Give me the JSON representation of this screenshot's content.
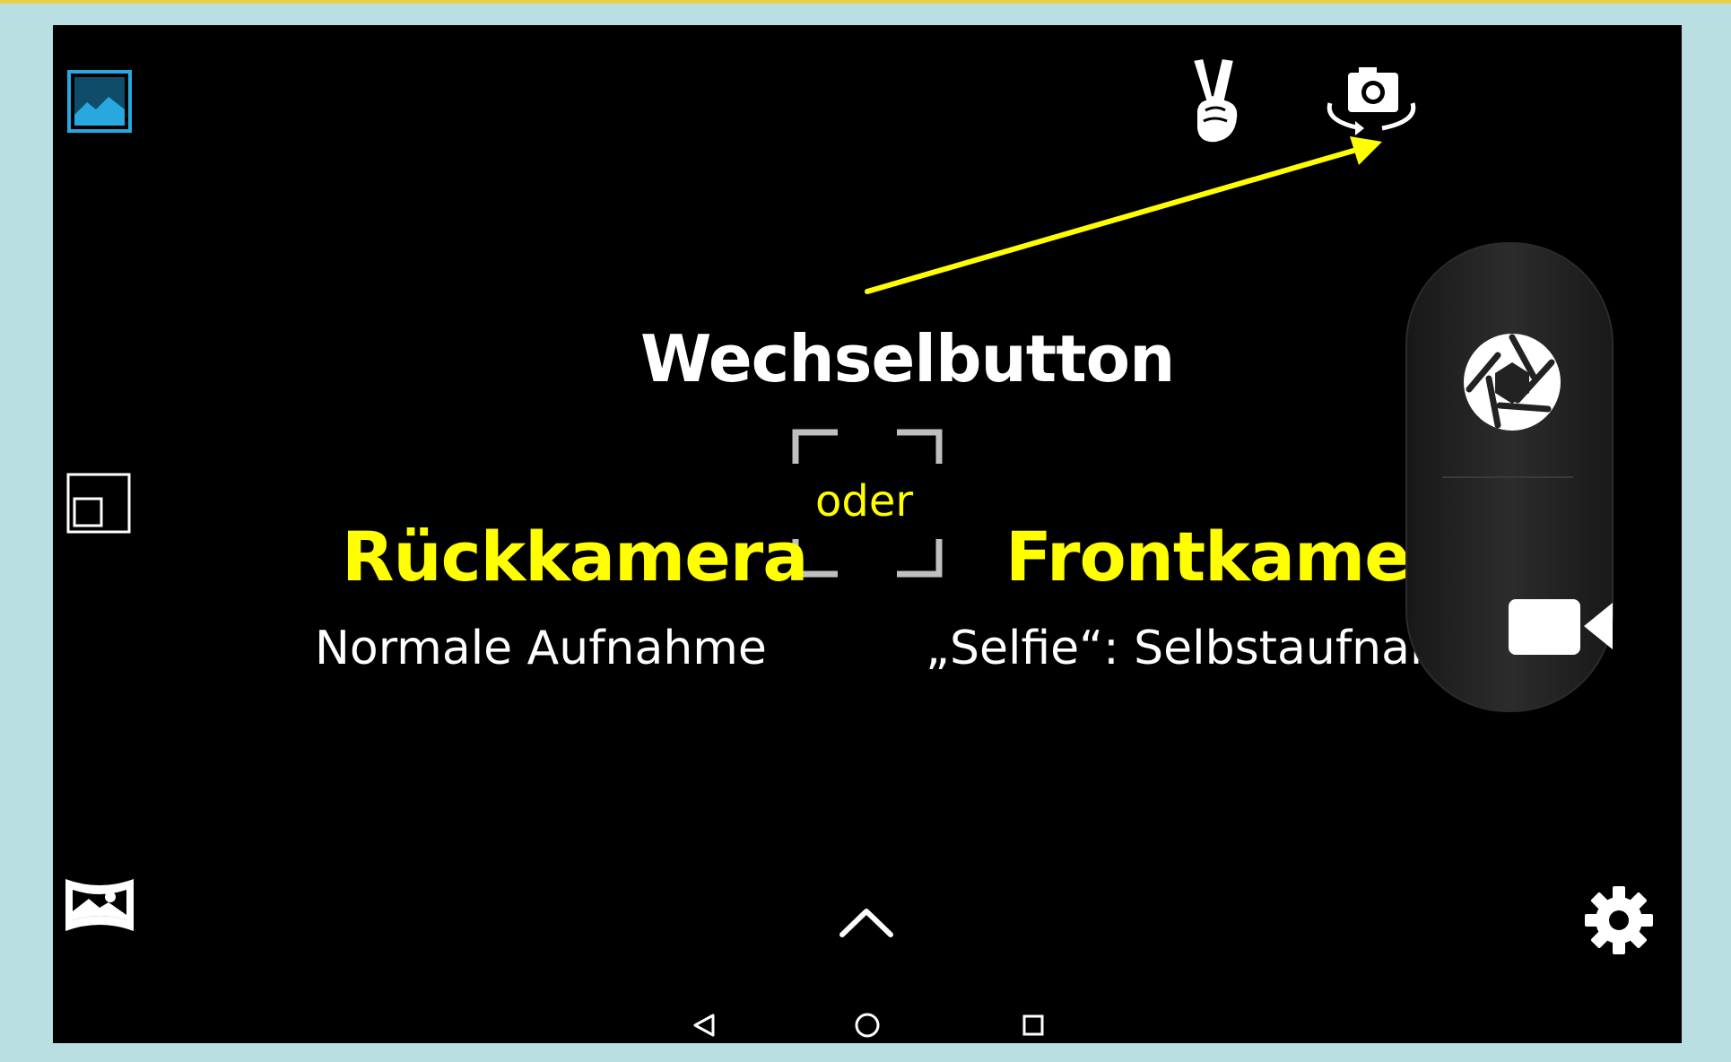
{
  "annotation": {
    "title": "Wechselbutton",
    "option_left": "Rückkamera",
    "option_connector": "oder",
    "option_right": "Frontkamera",
    "left_description": "Normale Aufnahme",
    "right_description": "„Selfie“: Selbstaufnahme",
    "arrow_color": "#ffff00"
  },
  "colors": {
    "frame": "#b9dfe3",
    "screen": "#000000",
    "highlight": "#ffff00",
    "gallery_accent": "#29a8e0"
  },
  "icons": {
    "gallery": "gallery-icon",
    "picture_in_picture": "picture-in-picture-icon",
    "panorama": "panorama-icon",
    "gesture": "victory-hand-icon",
    "switch_camera": "switch-camera-icon",
    "shutter": "shutter-icon",
    "video": "video-camera-icon",
    "settings": "gear-icon",
    "expand": "chevron-up-icon",
    "nav_back": "back-triangle-icon",
    "nav_home": "home-circle-icon",
    "nav_recents": "recents-square-icon"
  }
}
